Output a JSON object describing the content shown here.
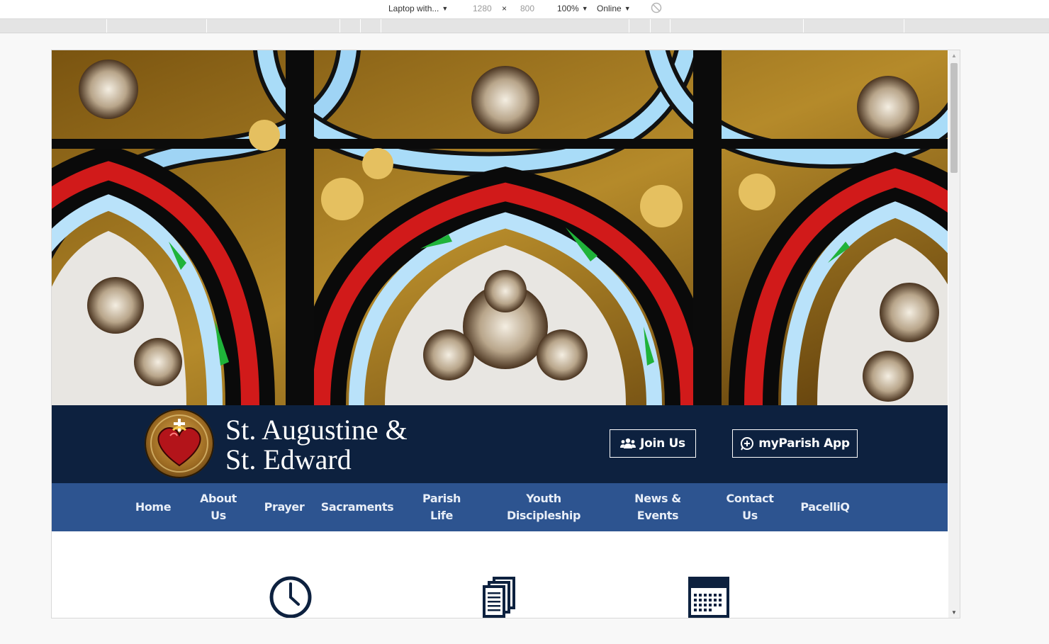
{
  "devtools": {
    "device": "Laptop with...",
    "width": "1280",
    "times": "×",
    "height": "800",
    "zoom": "100%",
    "network": "Online"
  },
  "header": {
    "title_line1": "St. Augustine &",
    "title_line2": "St. Edward",
    "join_label": "Join Us",
    "app_label": "myParish App"
  },
  "nav": {
    "items": [
      {
        "line1": "Home",
        "line2": ""
      },
      {
        "line1": "About",
        "line2": "Us"
      },
      {
        "line1": "Prayer",
        "line2": ""
      },
      {
        "line1": "Sacraments",
        "line2": ""
      },
      {
        "line1": "Parish",
        "line2": "Life"
      },
      {
        "line1": "Youth",
        "line2": "Discipleship"
      },
      {
        "line1": "News &",
        "line2": "Events"
      },
      {
        "line1": "Contact",
        "line2": "Us"
      },
      {
        "line1": "PacelliQ",
        "line2": ""
      }
    ]
  },
  "colors": {
    "header_bg": "#0d213f",
    "nav_bg": "#2d5490",
    "icon_color": "#0d213f"
  },
  "icons": {
    "clock": "clock-icon",
    "bulletin": "documents-icon",
    "calendar": "calendar-icon"
  }
}
